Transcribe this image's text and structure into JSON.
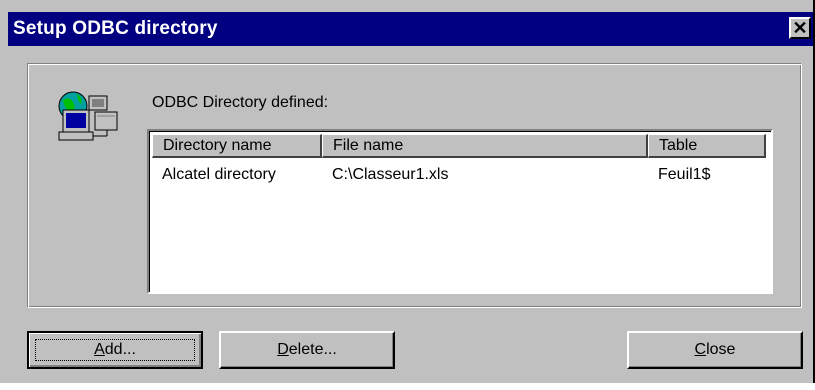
{
  "window": {
    "title": "Setup ODBC directory",
    "close_glyph": "✕"
  },
  "main": {
    "label": "ODBC Directory defined:",
    "icon": "network-computer-icon",
    "list": {
      "columns": [
        "Directory name",
        "File name",
        "Table"
      ],
      "rows": [
        [
          "Alcatel directory",
          "C:\\Classeur1.xls",
          "Feuil1$"
        ]
      ]
    }
  },
  "buttons": {
    "add_prefix": "",
    "add_mnemonic": "A",
    "add_rest": "dd...",
    "delete_mnemonic": "D",
    "delete_rest": "elete...",
    "close_mnemonic": "C",
    "close_rest": "lose"
  },
  "colors": {
    "titlebar": "#000080",
    "face": "#c0c0c0"
  }
}
